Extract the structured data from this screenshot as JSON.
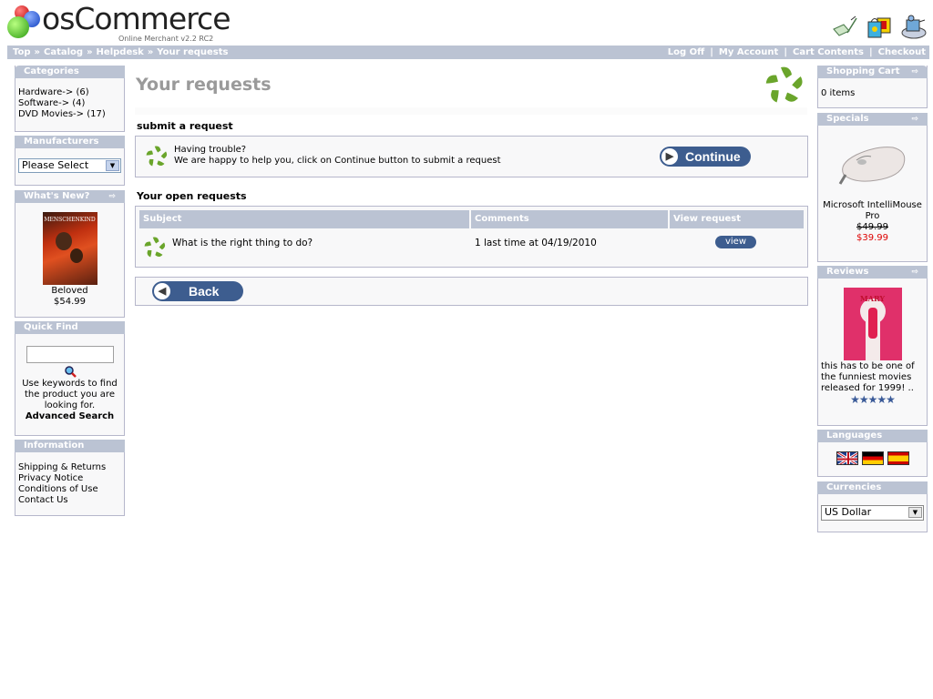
{
  "header": {
    "logo_main": "osCommerce",
    "logo_sub": "Online Merchant v2.2 RC2",
    "icons": [
      "my-account-icon",
      "cart-icon",
      "checkout-icon"
    ]
  },
  "navbar": {
    "breadcrumb": [
      "Top",
      "Catalog",
      "Helpdesk",
      "Your requests"
    ],
    "breadcrumb_sep": "»",
    "account_links": [
      "Log Off",
      "My Account",
      "Cart Contents",
      "Checkout"
    ],
    "account_sep": "|"
  },
  "left": {
    "categories": {
      "title": "Categories",
      "items": [
        "Hardware-> (6)",
        "Software-> (4)",
        "DVD Movies-> (17)"
      ]
    },
    "manufacturers": {
      "title": "Manufacturers",
      "selected": "Please Select"
    },
    "whats_new": {
      "title": "What's New?",
      "arrow": "⇨",
      "product_name": "Beloved",
      "price": "$54.99",
      "image_label": "MENSCHENKIND"
    },
    "quick_find": {
      "title": "Quick Find",
      "input_value": "",
      "help_text": "Use keywords to find the product you are looking for.",
      "advanced_link": "Advanced Search"
    },
    "information": {
      "title": "Information",
      "items": [
        "Shipping & Returns",
        "Privacy Notice",
        "Conditions of Use",
        "Contact Us"
      ]
    }
  },
  "main": {
    "title": "Your requests",
    "submit_heading": "submit a request",
    "trouble_line1": "Having trouble?",
    "trouble_line2": "We are happy to help you, click on Continue button to submit a request",
    "continue_label": "Continue",
    "open_heading": "Your open requests",
    "table": {
      "headers": [
        "Subject",
        "Comments",
        "View request"
      ],
      "rows": [
        {
          "subject": "What is the right thing to do?",
          "comments": "1 last time at 04/19/2010",
          "action": "view"
        }
      ]
    },
    "back_label": "Back"
  },
  "right": {
    "cart": {
      "title": "Shopping Cart",
      "arrow": "⇨",
      "content": "0 items"
    },
    "specials": {
      "title": "Specials",
      "arrow": "⇨",
      "product_name": "Microsoft IntelliMouse Pro",
      "old_price": "$49.99",
      "new_price": "$39.99"
    },
    "reviews": {
      "title": "Reviews",
      "arrow": "⇨",
      "text": "this has to be one of the funniest movies released for 1999! ..",
      "rating": 5,
      "stars": "★★★★★",
      "image_label": "MARY"
    },
    "languages": {
      "title": "Languages",
      "flags": [
        "english",
        "german",
        "spanish"
      ]
    },
    "currencies": {
      "title": "Currencies",
      "selected": "US Dollar"
    }
  },
  "colors": {
    "header_bar": "#bbc3d3",
    "box_border": "#b6b7cb",
    "box_bg": "#f8f8f9",
    "button_blue": "#3d5d8f",
    "title_gray": "#9a9a9a",
    "special_price": "#dd0000",
    "flower_green": "#6aa52b"
  }
}
